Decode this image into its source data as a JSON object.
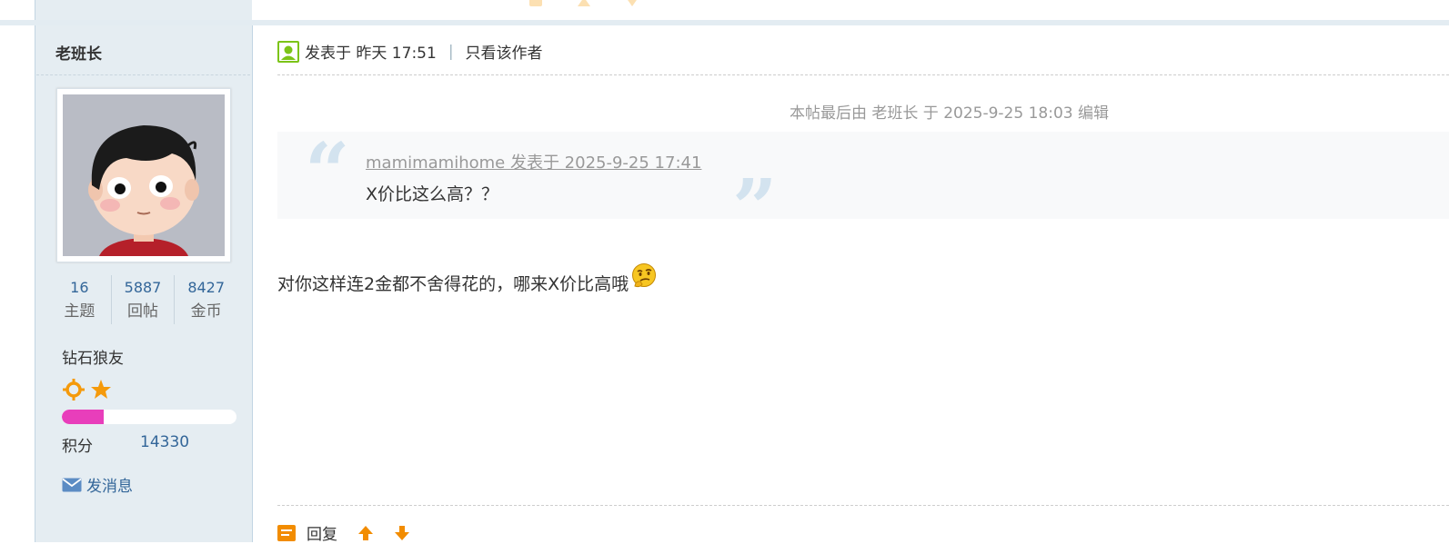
{
  "author": {
    "name": "老班长",
    "stats": [
      {
        "value": "16",
        "label": "主题"
      },
      {
        "value": "5887",
        "label": "回帖"
      },
      {
        "value": "8427",
        "label": "金币"
      }
    ],
    "rank": "钻石狼友",
    "rank_icons": [
      "sun-icon",
      "star-icon"
    ],
    "progress_fraction": 0.24,
    "points_label": "积分",
    "points_value": "14330",
    "message_label": "发消息"
  },
  "post": {
    "posted_label": "发表于 昨天 17:51",
    "separator": "|",
    "only_author_label": "只看该作者",
    "edit_note": "本帖最后由 老班长 于 2025-9-25 18:03 编辑",
    "quote": {
      "meta": "mamimamihome 发表于 2025-9-25 17:41",
      "text": "X价比这么高？？"
    },
    "body": "对你这样连2金都不舍得花的，哪来X价比高哦",
    "emoji": "thinking-emoji"
  },
  "actions": {
    "reply_label": "回复",
    "up_icon": "thumb-up-arrow-icon",
    "down_icon": "thumb-down-arrow-icon"
  },
  "colors": {
    "sidebar_bg": "#e5edf2",
    "link": "#336699",
    "accent_orange": "#f5a623",
    "progress_fill": "#e83ebb"
  }
}
